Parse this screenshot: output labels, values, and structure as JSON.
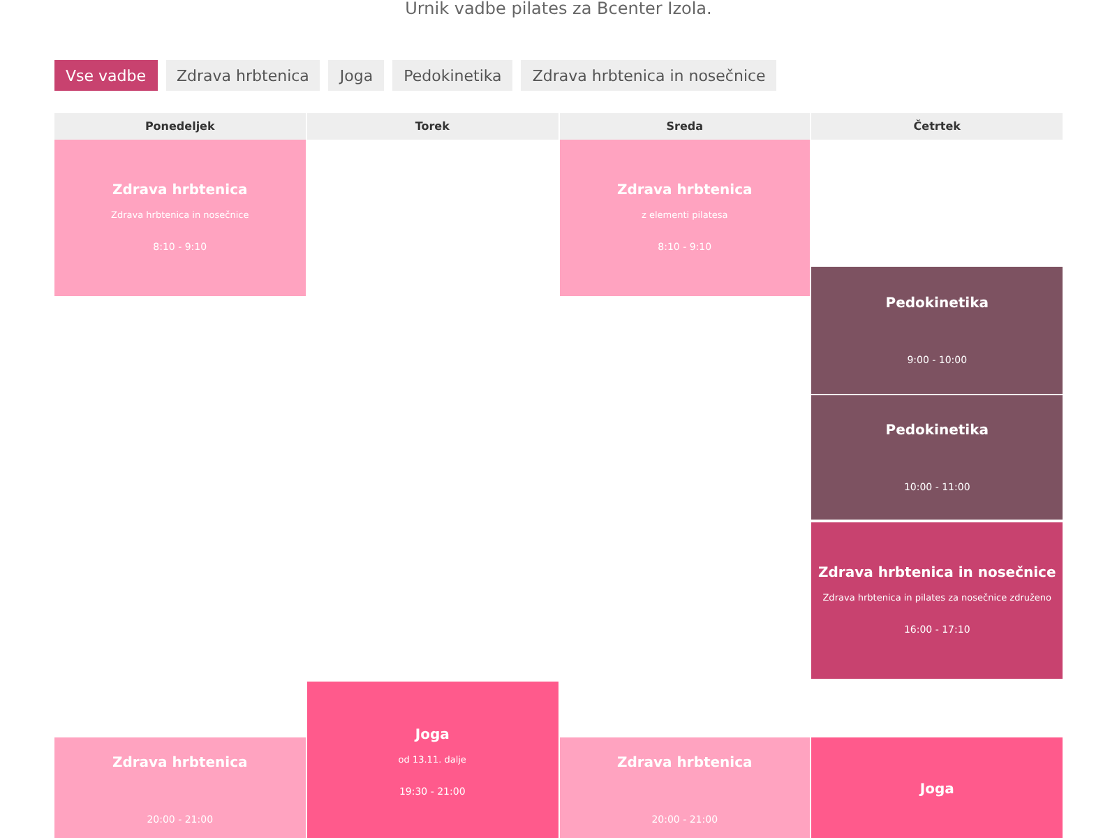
{
  "subtitle": "Urnik vadbe pilates za Bcenter Izola.",
  "filters": [
    {
      "label": "Vse vadbe",
      "selected": true
    },
    {
      "label": "Zdrava hrbtenica",
      "selected": false
    },
    {
      "label": "Joga",
      "selected": false
    },
    {
      "label": "Pedokinetika",
      "selected": false
    },
    {
      "label": "Zdrava hrbtenica in nosečnice",
      "selected": false
    }
  ],
  "days": [
    {
      "name": "Ponedeljek",
      "events": [
        {
          "title": "Zdrava hrbtenica",
          "note": "Zdrava hrbtenica in nosečnice",
          "time": "8:10 - 9:10",
          "color": "#ffa3c0"
        },
        {
          "title": "Zdrava hrbtenica",
          "time": "20:00 - 21:00",
          "color": "#ffa3c0"
        }
      ]
    },
    {
      "name": "Torek",
      "events": [
        {
          "title": "Joga",
          "note": "od 13.11. dalje",
          "time": "19:30 - 21:00",
          "color": "#ff5a8c"
        }
      ]
    },
    {
      "name": "Sreda",
      "events": [
        {
          "title": "Zdrava hrbtenica",
          "note": "z elementi pilatesa",
          "time": "8:10 - 9:10",
          "color": "#ffa3c0"
        },
        {
          "title": "Zdrava hrbtenica",
          "time": "20:00 - 21:00",
          "color": "#ffa3c0"
        }
      ]
    },
    {
      "name": "Četrtek",
      "events": [
        {
          "title": "Pedokinetika",
          "time": "9:00 - 10:00",
          "color": "#7d5261"
        },
        {
          "title": "Pedokinetika",
          "time": "10:00 - 11:00",
          "color": "#7d5261"
        },
        {
          "title": "Zdrava hrbtenica in nosečnice",
          "note": "Zdrava hrbtenica in pilates za nosečnice združeno",
          "time": "16:00 - 17:10",
          "color": "#c8426f"
        },
        {
          "title": "Joga",
          "color": "#ff5a8c"
        }
      ]
    }
  ]
}
